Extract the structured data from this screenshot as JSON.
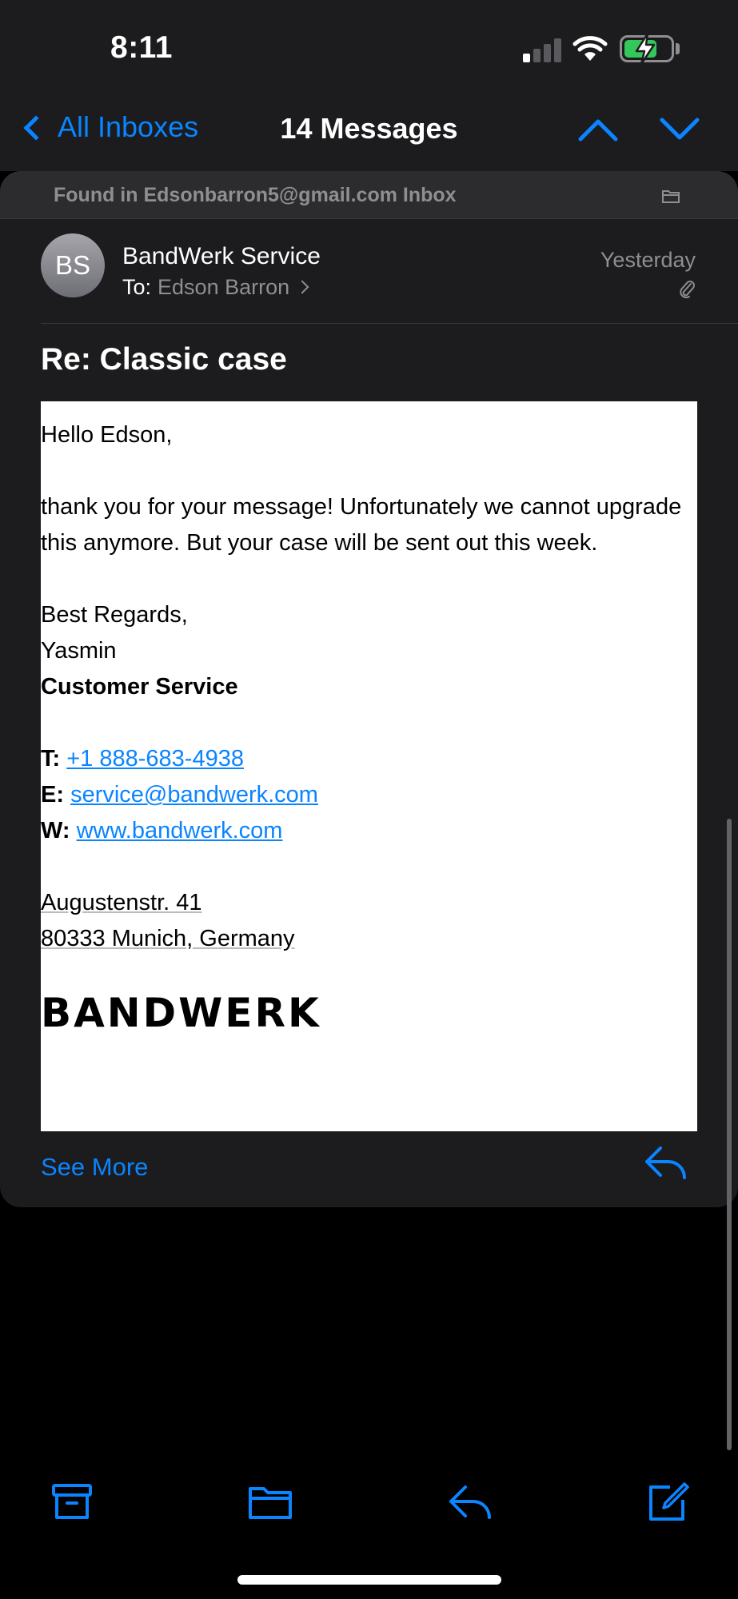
{
  "status_bar": {
    "time": "8:11",
    "signal_bars_active": 1,
    "battery_charging": true,
    "battery_level": 0.72
  },
  "nav": {
    "back_label": "All Inboxes",
    "title": "14 Messages",
    "up_icon": "chevron-up-icon",
    "down_icon": "chevron-down-icon"
  },
  "message": {
    "found_in": "Found in Edsonbarron5@gmail.com Inbox",
    "avatar_initials": "BS",
    "sender": "BandWerk Service",
    "to_label": "To:",
    "to_name": "Edson Barron",
    "date": "Yesterday",
    "subject": "Re: Classic case",
    "body": {
      "greeting": "Hello Edson,",
      "paragraph": "thank you for your message! Unfortunately we cannot upgrade this anymore. But your case will be sent out this week.",
      "closing": "Best Regards,",
      "name": "Yasmin",
      "role": "Customer Service",
      "phone_label": "T:",
      "phone": "+1 888-683-4938",
      "email_label": "E:",
      "email": "service@bandwerk.com",
      "web_label": "W:",
      "web": "www.bandwerk.com",
      "address_line1": "Augustenstr. 41",
      "address_line2": "80333 Munich, Germany",
      "logo": "BANDWERK"
    },
    "see_more": "See More"
  },
  "toolbar": {
    "items": [
      "archive-icon",
      "folder-icon",
      "reply-icon",
      "compose-icon"
    ]
  },
  "colors": {
    "accent": "#0a84ff",
    "background": "#000000",
    "surface": "#1c1c1e",
    "secondary_text": "#8e8e93"
  }
}
